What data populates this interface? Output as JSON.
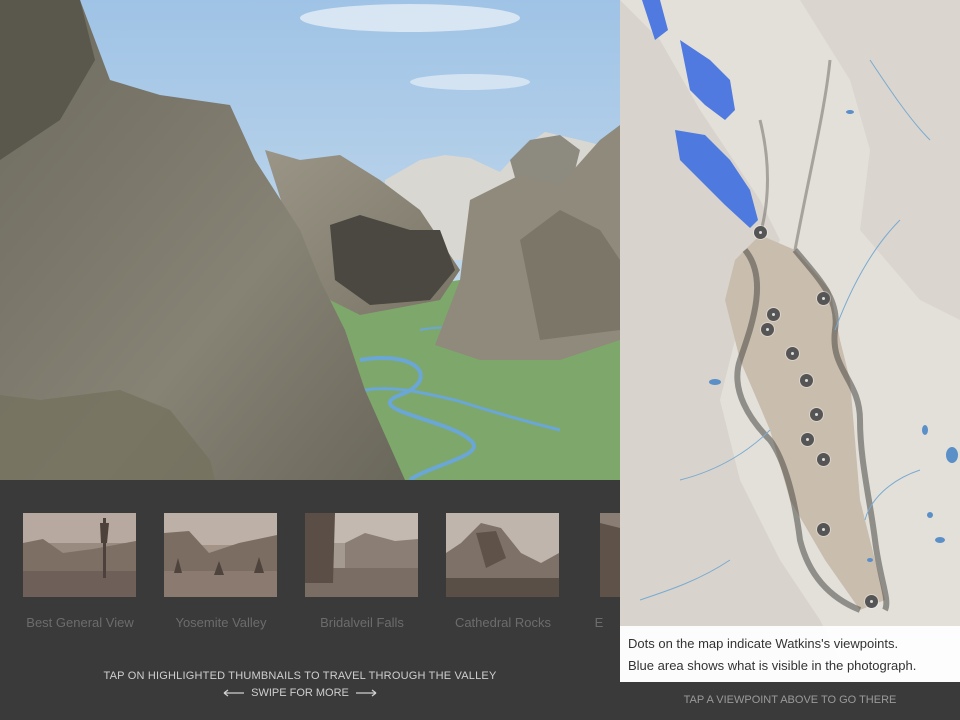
{
  "thumbnails": [
    {
      "caption": "Best General View"
    },
    {
      "caption": "Yosemite Valley"
    },
    {
      "caption": "Bridalveil Falls"
    },
    {
      "caption": "Cathedral Rocks"
    },
    {
      "caption": "E"
    }
  ],
  "hint": "TAP ON HIGHLIGHTED THUMBNAILS TO TRAVEL THROUGH THE VALLEY",
  "swipe": "SWIPE FOR MORE",
  "map": {
    "legend_line1": "Dots on the map indicate Watkins's viewpoints.",
    "legend_line2": "Blue area shows what is visible in the photograph.",
    "footer": "TAP A VIEWPOINT ABOVE TO GO THERE"
  },
  "colors": {
    "viewshed_blue": "#3f6fe0",
    "valley_green": "#7ea86b",
    "river_blue": "#6aa6d6",
    "sky_blue": "#bcd6ee"
  },
  "icons": [
    "arrow-left-icon",
    "arrow-right-icon",
    "viewpoint-dot-icon"
  ]
}
